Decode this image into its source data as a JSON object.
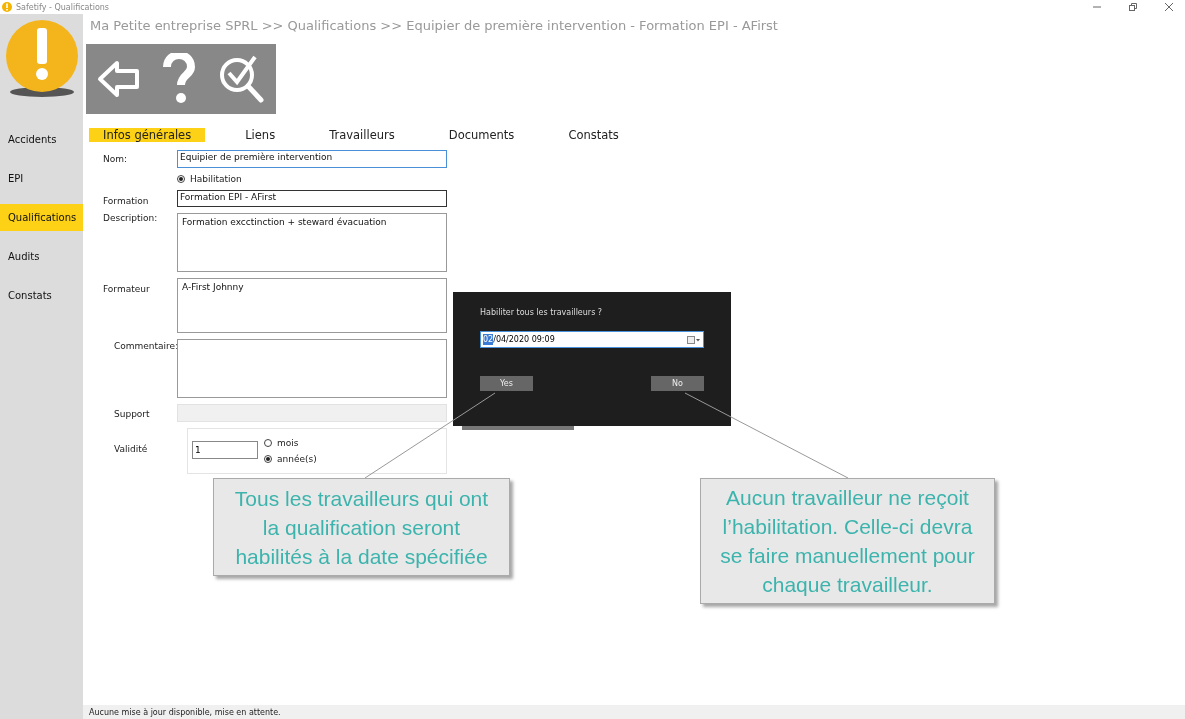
{
  "window": {
    "title": "Safetify - Qualifications"
  },
  "sidebar": {
    "items": [
      {
        "label": "Accidents",
        "selected": false
      },
      {
        "label": "EPI",
        "selected": false
      },
      {
        "label": "Qualifications",
        "selected": true
      },
      {
        "label": "Audits",
        "selected": false
      },
      {
        "label": "Constats",
        "selected": false
      }
    ]
  },
  "breadcrumb": "Ma Petite entreprise SPRL >> Qualifications >> Equipier de première intervention - Formation EPI - AFirst",
  "tabs": [
    {
      "label": "Infos générales",
      "selected": true
    },
    {
      "label": "Liens",
      "selected": false
    },
    {
      "label": "Travailleurs",
      "selected": false
    },
    {
      "label": "Documents",
      "selected": false
    },
    {
      "label": "Constats",
      "selected": false
    }
  ],
  "form": {
    "nom": {
      "label": "Nom:",
      "value": "Equipier de première intervention"
    },
    "habilitation": {
      "label": "Habilitation",
      "checked": true
    },
    "formation": {
      "label": "Formation",
      "value": "Formation EPI - AFirst"
    },
    "description": {
      "label": "Description:",
      "value": "Formation excctinction + steward évacuation"
    },
    "formateur": {
      "label": "Formateur",
      "value": "A-First Johnny"
    },
    "commentaire": {
      "label": "Commentaire:"
    },
    "support": {
      "label": "Support"
    },
    "validite": {
      "label": "Validité",
      "value": "1",
      "options": [
        {
          "label": "mois",
          "selected": false
        },
        {
          "label": "année(s)",
          "selected": true
        }
      ]
    }
  },
  "dialog": {
    "question": "Habiliter tous les travailleurs ?",
    "date_highlight": "02",
    "date_rest": "/04/2020 09:09",
    "buttons": [
      "Yes",
      "No"
    ]
  },
  "callouts": [
    "Tous les travailleurs qui ont la qualification seront habilités à la date spécifiée",
    "Aucun travailleur ne reçoit l’habilitation. Celle-ci devra se faire manuellement pour chaque travailleur."
  ],
  "status_bar": "Aucune mise à jour disponible, mise en attente."
}
